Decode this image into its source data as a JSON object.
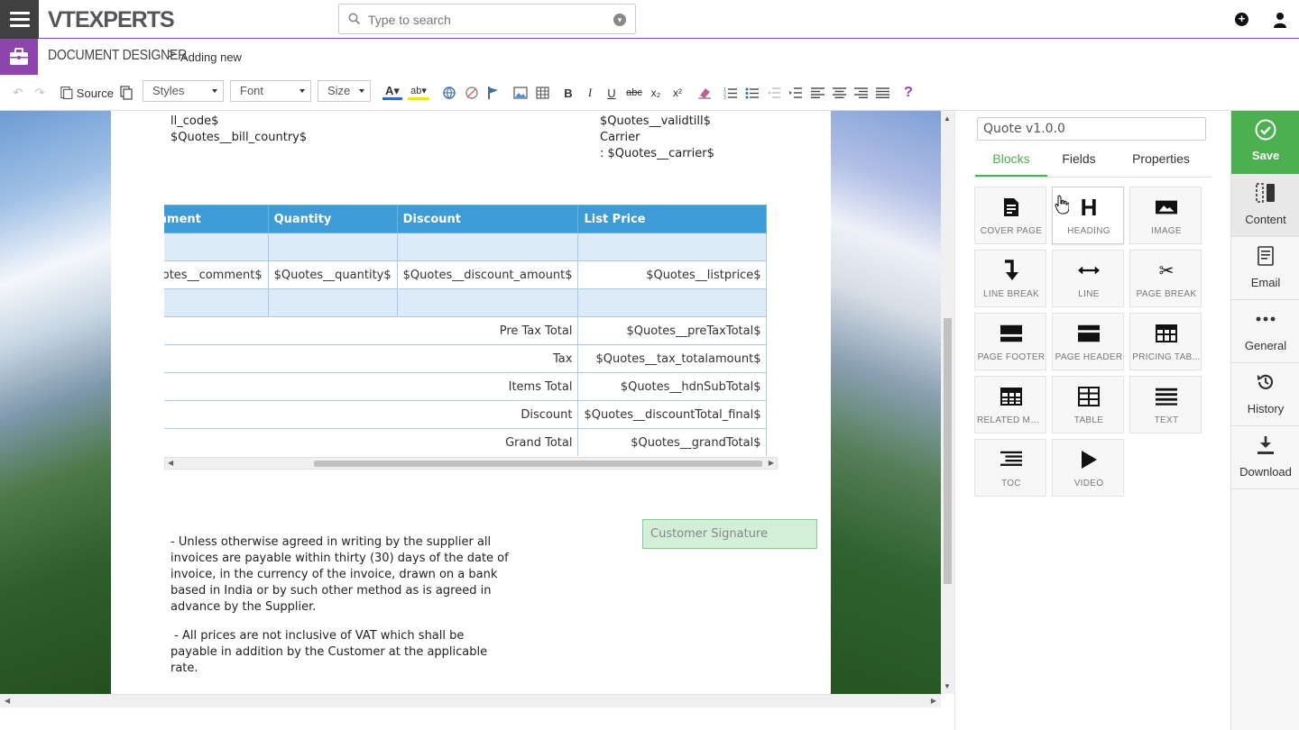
{
  "brand": {
    "logo_text": "VTEXPERTS"
  },
  "search": {
    "placeholder": "Type to search"
  },
  "breadcrumb": {
    "module": "DOCUMENT DESIGNER",
    "separator": ">",
    "page": "Adding new"
  },
  "toolbar": {
    "source_label": "Source",
    "styles_label": "Styles",
    "font_label": "Font",
    "size_label": "Size",
    "bold": "B",
    "italic": "I",
    "underline": "U",
    "strike": "abc",
    "sub": "x₂",
    "sup": "x²",
    "help": "?"
  },
  "document": {
    "top_left_lines": [
      "ll_code$",
      "$Quotes__bill_country$"
    ],
    "top_right_lines": [
      "$Quotes__validtill$",
      "Carrier",
      ": $Quotes__carrier$"
    ],
    "table": {
      "headers": [
        "Comment",
        "Quantity",
        "Discount",
        "List Price"
      ],
      "item_row": [
        "$Quotes__comment$",
        "$Quotes__quantity$",
        "$Quotes__discount_amount$",
        "$Quotes__listprice$"
      ],
      "totals": [
        {
          "label": "Pre Tax Total",
          "value": "$Quotes__preTaxTotal$"
        },
        {
          "label": "Tax",
          "value": "$Quotes__tax_totalamount$"
        },
        {
          "label": "Items Total",
          "value": "$Quotes__hdnSubTotal$"
        },
        {
          "label": "Discount",
          "value": "$Quotes__discountTotal_final$"
        },
        {
          "label": "Grand Total",
          "value": "$Quotes__grandTotal$"
        }
      ]
    },
    "signature": "Customer Signature",
    "terms": [
      "- Unless otherwise agreed in writing by the supplier all invoices are payable within thirty (30) days of the date of invoice, in the currency of the invoice, drawn on a bank based in India or by such other method as is agreed in advance by the Supplier.",
      " - All prices are not inclusive of VAT which shall be payable in addition by the Customer at the applicable rate."
    ]
  },
  "panel": {
    "template_name": "Quote v1.0.0",
    "tabs": [
      "Blocks",
      "Fields",
      "Properties"
    ],
    "active_tab": "Blocks",
    "blocks": [
      {
        "label": "COVER PAGE",
        "icon": "cover-page-icon"
      },
      {
        "label": "HEADING",
        "icon": "heading-icon"
      },
      {
        "label": "IMAGE",
        "icon": "image-icon"
      },
      {
        "label": "LINE BREAK",
        "icon": "line-break-icon"
      },
      {
        "label": "LINE",
        "icon": "line-icon"
      },
      {
        "label": "PAGE BREAK",
        "icon": "page-break-icon"
      },
      {
        "label": "PAGE FOOTER",
        "icon": "page-footer-icon"
      },
      {
        "label": "PAGE HEADER",
        "icon": "page-header-icon"
      },
      {
        "label": "PRICING TAB...",
        "icon": "pricing-table-icon"
      },
      {
        "label": "RELATED MO...",
        "icon": "related-modules-icon"
      },
      {
        "label": "TABLE",
        "icon": "table-icon"
      },
      {
        "label": "TEXT",
        "icon": "text-icon"
      },
      {
        "label": "TOC",
        "icon": "toc-icon"
      },
      {
        "label": "VIDEO",
        "icon": "video-icon"
      }
    ]
  },
  "rightnav": {
    "items": [
      {
        "label": "Save",
        "icon": "check-circle-icon"
      },
      {
        "label": "Content",
        "icon": "content-icon"
      },
      {
        "label": "Email",
        "icon": "email-icon"
      },
      {
        "label": "General",
        "icon": "more-icon"
      },
      {
        "label": "History",
        "icon": "history-icon"
      },
      {
        "label": "Download",
        "icon": "download-icon"
      }
    ]
  },
  "colors": {
    "accent": "#8e44ad",
    "save": "#4caf50",
    "table_header": "#3d9bd6"
  }
}
